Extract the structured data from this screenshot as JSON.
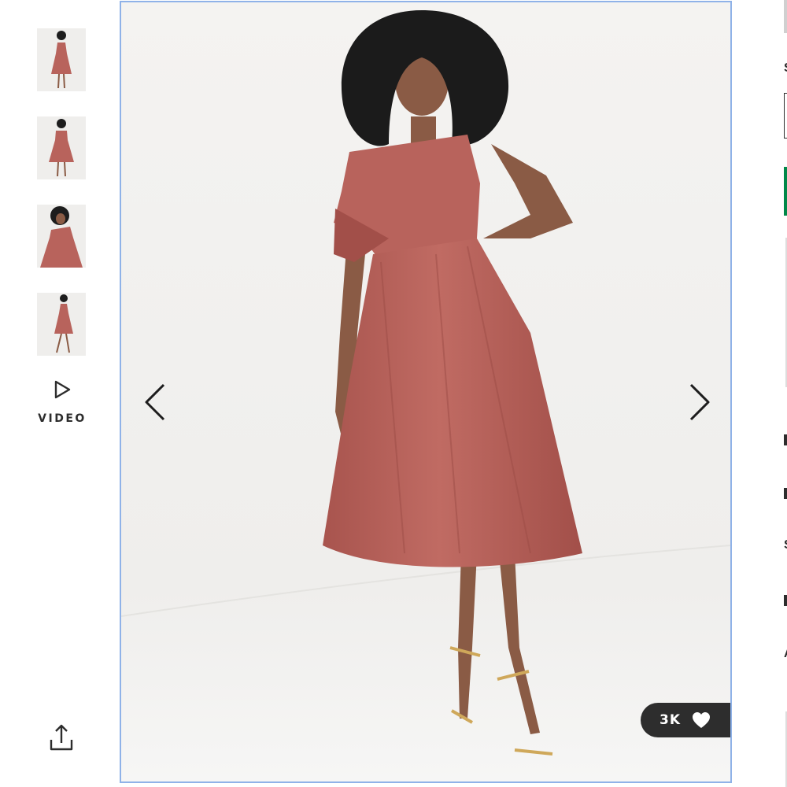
{
  "gallery": {
    "thumbnails": [
      {
        "name": "front-view"
      },
      {
        "name": "back-view"
      },
      {
        "name": "close-up-view"
      },
      {
        "name": "full-length-view"
      }
    ],
    "video_label": "VIDEO",
    "share_icon": "share-icon",
    "prev_icon": "chevron-left-icon",
    "next_icon": "chevron-right-icon"
  },
  "product_image": {
    "saves_count": "3K",
    "saves_icon": "heart-icon"
  },
  "right_panel": {
    "letters": [
      "S",
      "S",
      "A"
    ]
  },
  "colors": {
    "dress": "#b8635c",
    "badge_bg": "#2d2d2d",
    "viewer_border": "#8fb2e8",
    "accent_green": "#018849"
  }
}
